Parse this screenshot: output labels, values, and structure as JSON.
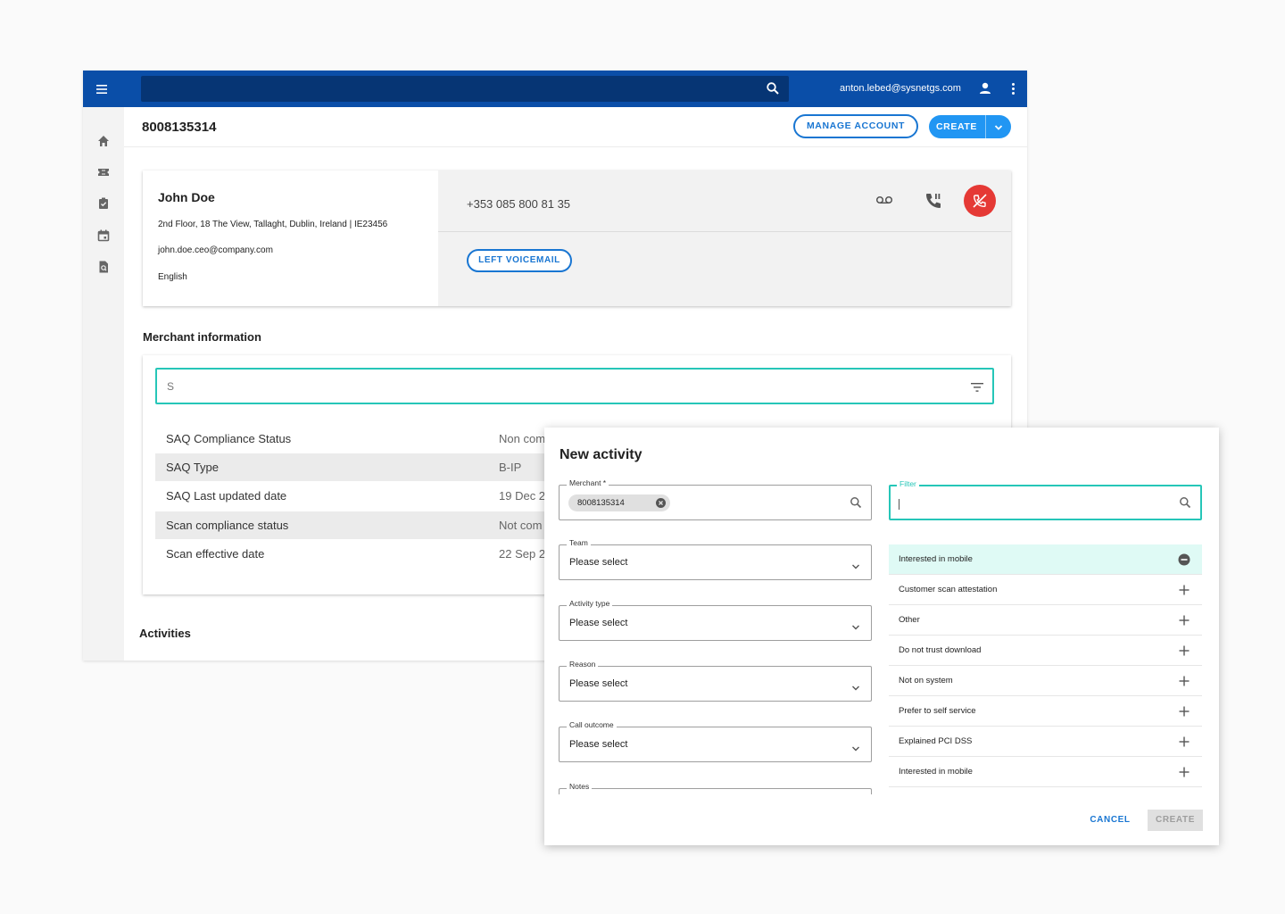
{
  "topbar": {
    "user_email": "anton.lebed@sysnetgs.com"
  },
  "account": {
    "number": "8008135314",
    "manage_label": "MANAGE ACCOUNT",
    "create_label": "CREATE"
  },
  "contact": {
    "name": "John Doe",
    "address": "2nd Floor, 18 The View, Tallaght, Dublin, Ireland  | IE23456",
    "email": "john.doe.ceo@company.com",
    "language": "English",
    "phone": "+353 085 800 81 35",
    "voicemail_label": "LEFT VOICEMAIL"
  },
  "merchant": {
    "section_title": "Merchant  information",
    "filter_value": "S",
    "rows": [
      {
        "label": "SAQ Compliance Status",
        "value": "Non com"
      },
      {
        "label": "SAQ Type",
        "value": "B-IP"
      },
      {
        "label": "SAQ Last updated date",
        "value": "19 Dec 2"
      },
      {
        "label": "Scan compliance status",
        "value": "Not com"
      },
      {
        "label": "Scan effective date",
        "value": "22 Sep 2"
      }
    ]
  },
  "activities": {
    "title": "Activities"
  },
  "dialog": {
    "title": "New activity",
    "merchant_label": "Merchant *",
    "merchant_chip": "8008135314",
    "team_label": "Team",
    "team_value": "Please select",
    "activity_type_label": "Activity type",
    "activity_type_value": "Please select",
    "reason_label": "Reason",
    "reason_value": "Please select",
    "call_outcome_label": "Call outcome",
    "call_outcome_value": "Please select",
    "notes_label": "Notes",
    "filter_label": "Filter",
    "options": [
      {
        "label": "Interested in mobile",
        "selected": true
      },
      {
        "label": "Customer scan attestation",
        "selected": false
      },
      {
        "label": "Other",
        "selected": false
      },
      {
        "label": "Do not trust download",
        "selected": false
      },
      {
        "label": "Not on system",
        "selected": false
      },
      {
        "label": "Prefer to self service",
        "selected": false
      },
      {
        "label": "Explained PCI DSS",
        "selected": false
      },
      {
        "label": "Interested in mobile",
        "selected": false
      }
    ],
    "cancel_label": "CANCEL",
    "create_label": "CREATE"
  },
  "colors": {
    "topbar": "#0a4ea8",
    "accent": "#2196f3",
    "focus": "#26c6b8",
    "hangup": "#e53935"
  },
  "icons": [
    "menu-icon",
    "search-icon",
    "user-icon",
    "more-vert-icon",
    "home-icon",
    "ticket-icon",
    "clipboard-check-icon",
    "calendar-icon",
    "document-search-icon",
    "chevron-down-icon",
    "voicemail-icon",
    "phone-paused-icon",
    "phone-hangup-icon",
    "filter-list-icon",
    "close-circle-icon",
    "remove-circle-icon",
    "plus-icon"
  ]
}
